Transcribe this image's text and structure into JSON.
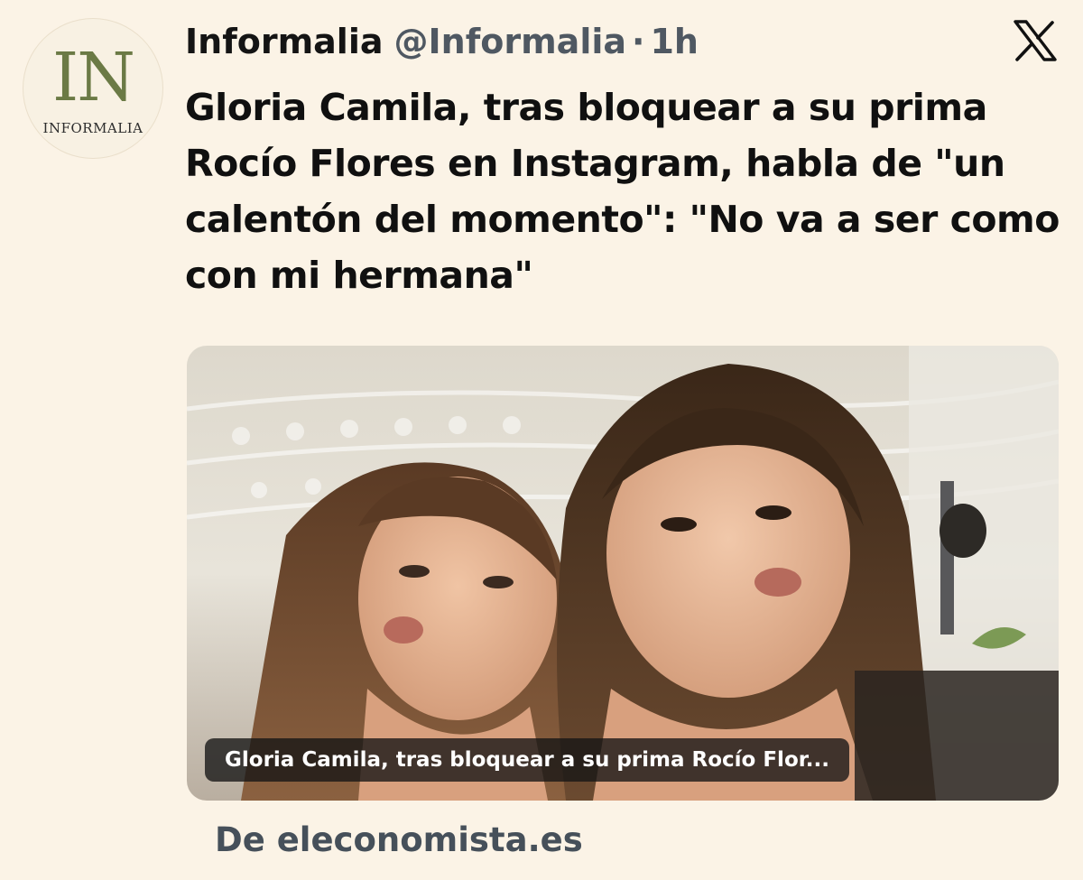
{
  "account": {
    "avatar_letters": "IN",
    "avatar_wordmark": "INFORMALIA",
    "display_name": "Informalia",
    "handle": "@Informalia",
    "separator": "·",
    "time": "1h",
    "platform_icon": "x-logo-icon"
  },
  "post": {
    "headline": "Gloria Camila, tras bloquear a su prima Rocío Flores en Instagram, habla de \"un calentón del momento\": \"No va a ser como con mi hermana\""
  },
  "link_card": {
    "image_icon": "photo-two-women-selfie",
    "caption": "Gloria Camila, tras bloquear a su prima Rocío Flor...",
    "source": "De eleconomista.es"
  },
  "colors": {
    "background": "#fbf3e6",
    "text": "#141414",
    "secondary_text": "#4f5862",
    "brand_green": "#6b7a45"
  }
}
